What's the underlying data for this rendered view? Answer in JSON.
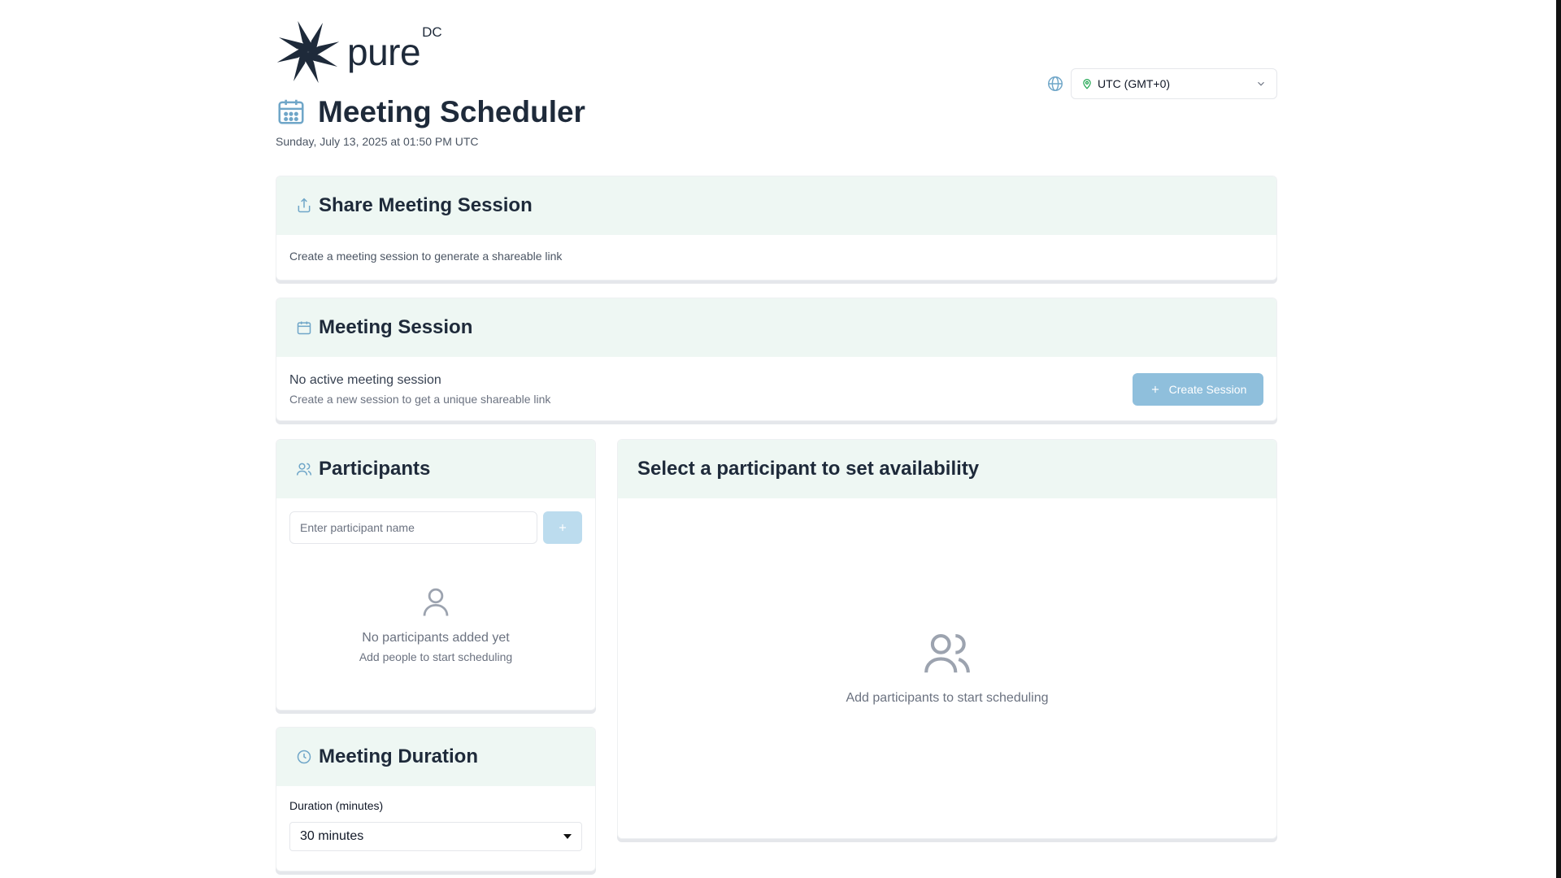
{
  "brand": {
    "name": "pure",
    "suffix": "DC"
  },
  "timezone": {
    "selected": "UTC (GMT+0)"
  },
  "header": {
    "title": "Meeting Scheduler",
    "datetime": "Sunday, July 13, 2025 at 01:50 PM UTC"
  },
  "share_card": {
    "title": "Share Meeting Session",
    "description": "Create a meeting session to generate a shareable link"
  },
  "session_card": {
    "title": "Meeting Session",
    "status": "No active meeting session",
    "hint": "Create a new session to get a unique shareable link",
    "create_label": "Create Session"
  },
  "participants_card": {
    "title": "Participants",
    "input_placeholder": "Enter participant name",
    "empty_title": "No participants added yet",
    "empty_hint": "Add people to start scheduling"
  },
  "availability_card": {
    "title": "Select a participant to set availability",
    "empty_text": "Add participants to start scheduling"
  },
  "duration_card": {
    "title": "Meeting Duration",
    "label": "Duration (minutes)",
    "selected": "30 minutes"
  },
  "colors": {
    "header_bg": "#eef7f3",
    "accent": "#8fbfdc",
    "brand_dark": "#1e2a3a"
  }
}
